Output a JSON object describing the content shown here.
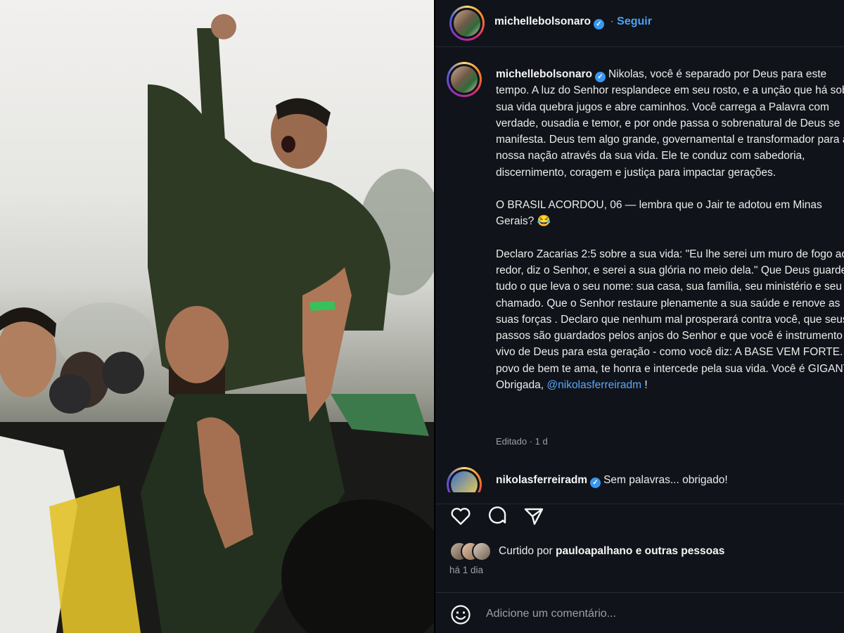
{
  "photo": {
    "description_icon": "crowd-photo"
  },
  "post": {
    "username": "michellebolsonaro",
    "follow_label": "Seguir",
    "caption": {
      "username": "michellebolsonaro",
      "paragraph1": "Nikolas, você é separado por Deus para este tempo. A luz do Senhor resplandece em seu rosto, e a unção que há sobre sua vida quebra jugos e abre caminhos. Você carrega a Palavra com verdade, ousadia e temor, e por onde passa o sobrenatural de Deus se manifesta. Deus tem algo grande, governamental e transformador para a nossa nação através da sua vida. Ele te conduz com sabedoria, discernimento, coragem e justiça para impactar gerações.",
      "paragraph2": "O BRASIL ACORDOU, 06 — lembra que o Jair te adotou em Minas Gerais? 😂",
      "paragraph3": "Declaro Zacarias 2:5 sobre a sua vida: \"Eu lhe serei um muro de fogo ao redor, diz o Senhor, e serei a sua glória no meio dela.\" Que Deus guarde tudo o que leva o seu nome: sua casa, sua família, seu ministério e seu chamado. Que o Senhor restaure plenamente a sua saúde e renove as suas forças . Declaro que nenhum mal prosperará contra você, que seus passos são guardados pelos anjos do Senhor e que você é instrumento vivo de Deus para esta geração - como você diz: A BASE VEM FORTE. O povo de bem te ama, te honra e intercede pela sua vida. Você é GIGANTE! Obrigada,",
      "mention": "@nikolasferreiradm",
      "ending": "!",
      "edited": "Editado · 1 d"
    },
    "reply": {
      "username": "nikolasferreiradm",
      "text": "Sem palavras... obrigado!"
    },
    "likes": {
      "prefix": "Curtido por",
      "user": "paulo​apalhano",
      "suffix": "e outras pessoas"
    },
    "time": "há 1 dia",
    "comment_placeholder": "Adicione um comentário..."
  },
  "icons": [
    "verified-badge",
    "heart-icon",
    "comment-icon",
    "share-icon",
    "emoji-icon"
  ],
  "colors": {
    "panel_bg": "#101319",
    "link": "#4aa3f7",
    "verified": "#3897f0"
  }
}
